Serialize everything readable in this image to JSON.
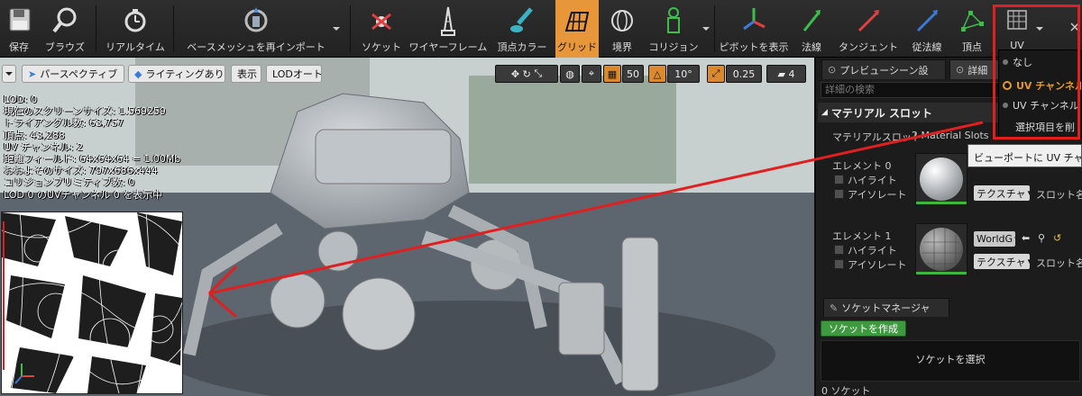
{
  "toolbar": {
    "buttons": [
      {
        "label": "保存",
        "icon": "save-icon"
      },
      {
        "label": "ブラウズ",
        "icon": "browse-icon"
      },
      {
        "label": "リアルタイム",
        "icon": "realtime-icon"
      },
      {
        "label": "ベースメッシュを再インポート",
        "icon": "reimport-icon"
      },
      {
        "label": "ソケット",
        "icon": "socket-icon"
      },
      {
        "label": "ワイヤーフレーム",
        "icon": "wireframe-icon"
      },
      {
        "label": "頂点カラー",
        "icon": "vertex-color-icon"
      },
      {
        "label": "グリッド",
        "icon": "grid-icon"
      },
      {
        "label": "境界",
        "icon": "bounds-icon"
      },
      {
        "label": "コリジョン",
        "icon": "collision-icon"
      },
      {
        "label": "ピボットを表示",
        "icon": "pivot-icon"
      },
      {
        "label": "法線",
        "icon": "normals-icon"
      },
      {
        "label": "タンジェント",
        "icon": "tangents-icon"
      },
      {
        "label": "従法線",
        "icon": "binormals-icon"
      },
      {
        "label": "頂点",
        "icon": "vertices-icon"
      },
      {
        "label": "UV",
        "icon": "uv-icon"
      }
    ]
  },
  "viewport": {
    "perspective_label": "パースペクティブ",
    "lighting_label": "ライティングあり",
    "show_label": "表示",
    "lod_label": "LODオート",
    "grid_snap": "50",
    "rot_snap": "10°",
    "scale_snap": "0.25",
    "cam_speed": "4",
    "stats": [
      "LOD: 0",
      "現在のスクリーンサイズ: 1.569259",
      "トライアングル数: 63,757",
      "頂点: 43,288",
      "UV チャンネル: 2",
      "距離フィールド: 64x64x64 = 1.00Mb",
      "おおよそのサイズ: 797x686x444",
      "コリジョンプリミティブ数: 0",
      "LOD 0 のUVチャンネル 0 を表示中"
    ]
  },
  "details": {
    "tab_preview": "プレビューシーン設",
    "tab_details": "詳細",
    "search_placeholder": "詳細の検索",
    "material_slots_header": "マテリアル スロット",
    "material_slots_label": "マテリアルスロット",
    "material_slots_value": "2 Material Slots",
    "elements": [
      {
        "name": "エレメント 0",
        "highlight": "ハイライト",
        "isolate": "アイソレート",
        "combo": "テクスチャ",
        "slot_name": "スロット名"
      },
      {
        "name": "エレメント 1",
        "highlight": "ハイライト",
        "isolate": "アイソレート",
        "combo": "テクスチャ",
        "slot_name": "スロット名",
        "material": "WorldG"
      }
    ]
  },
  "sockets": {
    "tab": "ソケットマネージャ",
    "create_button": "ソケットを作成",
    "select_text": "ソケットを選択",
    "count_text": "0 ソケット"
  },
  "uv_menu": {
    "items": [
      "なし",
      "UV チャンネル",
      "UV チャンネル",
      "選択項目を削"
    ],
    "selected_index": 1
  },
  "tooltip": "ビューポートに UV チャンネ",
  "colors": {
    "accent": "#e8963a",
    "annotation": "#e02020",
    "create_button": "#3e9a3e"
  }
}
